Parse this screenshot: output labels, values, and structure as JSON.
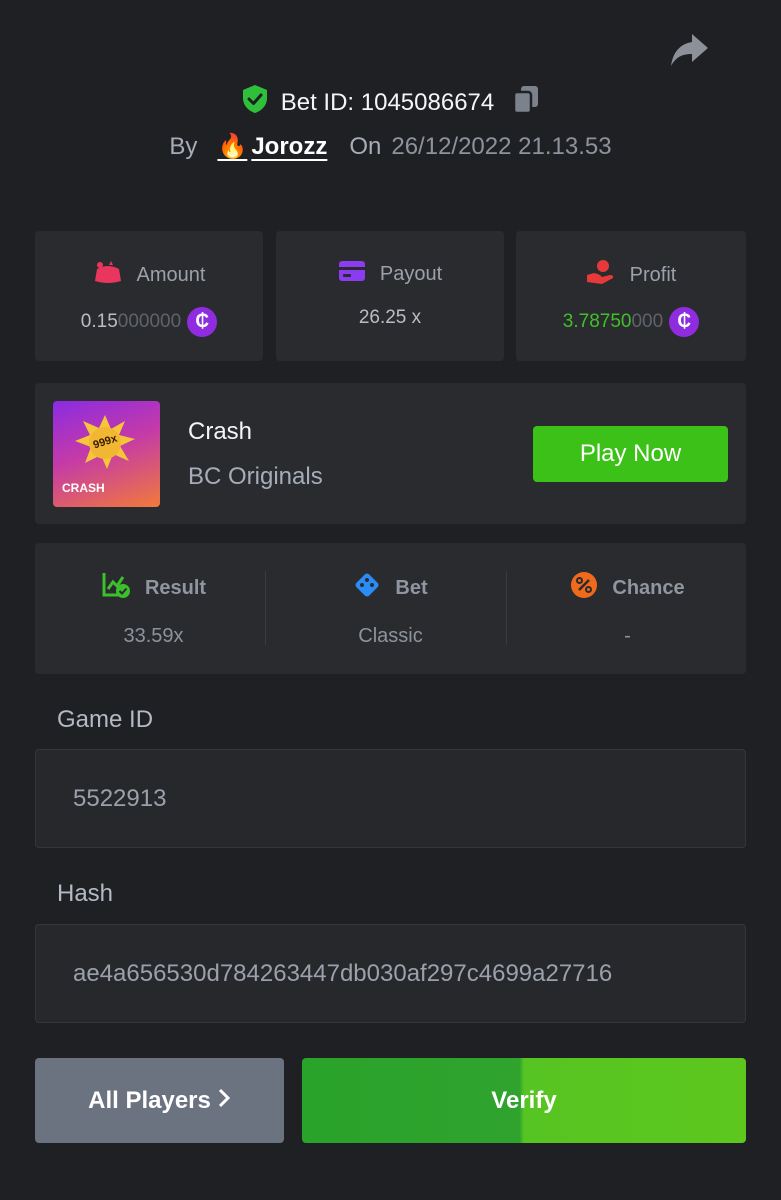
{
  "header": {
    "bet_id_label": "Bet ID: 1045086674",
    "by_label": "By",
    "user_emoji": "🔥",
    "username": "Jorozz",
    "on_label": "On",
    "datetime": "26/12/2022 21.13.53"
  },
  "stats": {
    "amount": {
      "label": "Amount",
      "value_main": "0.15",
      "value_dim": "000000",
      "icon": "money-bag-icon"
    },
    "payout": {
      "label": "Payout",
      "value": "26.25 x",
      "icon": "wallet-icon"
    },
    "profit": {
      "label": "Profit",
      "value_main": "3.78750",
      "value_dim": "000",
      "icon": "hand-coin-icon"
    },
    "coin_symbol": "₵"
  },
  "game": {
    "name": "Crash",
    "provider": "BC Originals",
    "thumb_multiplier": "999x",
    "thumb_label": "CRASH",
    "play_label": "Play Now"
  },
  "details": {
    "result": {
      "label": "Result",
      "value": "33.59x"
    },
    "bet": {
      "label": "Bet",
      "value": "Classic"
    },
    "chance": {
      "label": "Chance",
      "value": "-"
    }
  },
  "fields": {
    "game_id_label": "Game ID",
    "game_id_value": "5522913",
    "hash_label": "Hash",
    "hash_value": "ae4a656530d784263447db030af297c4699a27716"
  },
  "actions": {
    "all_players_label": "All Players",
    "verify_label": "Verify"
  },
  "colors": {
    "background": "#1f2023",
    "card": "#2a2b2f",
    "accent_green": "#3bc117",
    "profit_green": "#3fc02a",
    "coin_purple": "#8f2ce0"
  }
}
